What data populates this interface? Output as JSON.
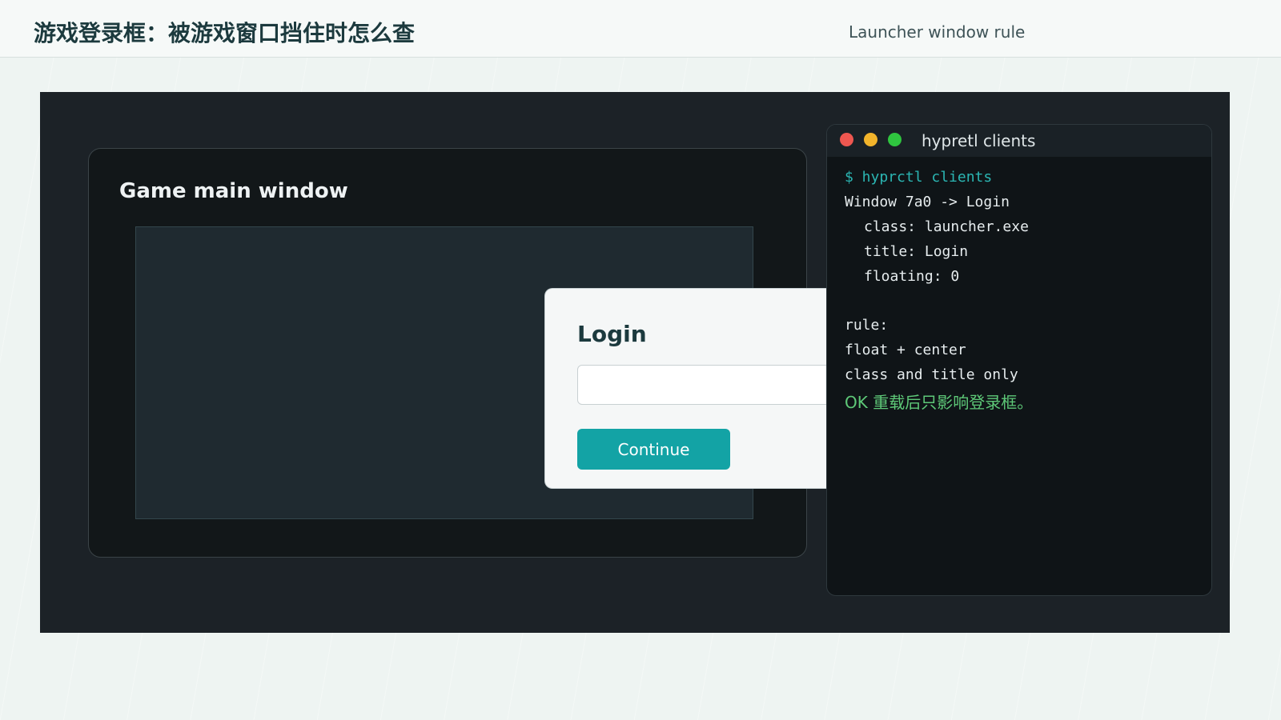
{
  "header": {
    "title": "游戏登录框：被游戏窗口挡住时怎么查",
    "subtitle": "Launcher window rule"
  },
  "game_window": {
    "title": "Game main window"
  },
  "login_dialog": {
    "title": "Login",
    "input_value": "",
    "continue_label": "Continue"
  },
  "terminal": {
    "title": "hypretl clients",
    "lines": {
      "command": "$ hyprctl clients",
      "window": "Window 7a0 -> Login",
      "class": "class: launcher.exe",
      "title_line": "title: Login",
      "floating": "floating: 0",
      "rule": "rule:",
      "rule_float": "float + center",
      "rule_class": "class and title only",
      "ok": "OK 重载后只影响登录框。"
    }
  },
  "colors": {
    "accent": "#13a3a5",
    "ok_text": "#5ec978",
    "command_text": "#2bb6b3",
    "dot_red": "#ee5750",
    "dot_yellow": "#f2b42b",
    "dot_green": "#2fc53f"
  }
}
